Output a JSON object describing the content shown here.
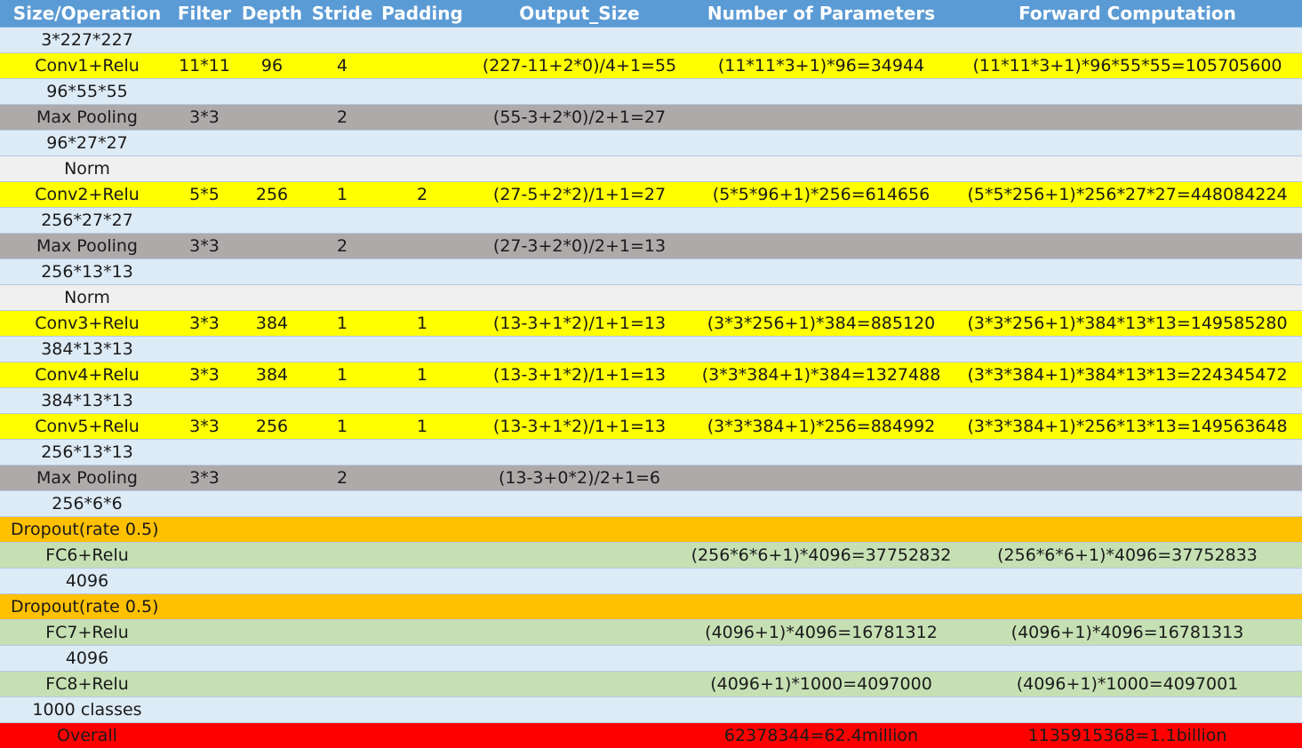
{
  "table": {
    "headers": [
      "Size/Operation",
      "Filter",
      "Depth",
      "Stride",
      "Padding",
      "Output_Size",
      "Number of Parameters",
      "Forward Computation"
    ],
    "rows": [
      {
        "kind": "size",
        "cells": [
          "3*227*227",
          "",
          "",
          "",
          "",
          "",
          "",
          ""
        ]
      },
      {
        "kind": "conv",
        "cells": [
          "Conv1+Relu",
          "11*11",
          "96",
          "4",
          "",
          "(227-11+2*0)/4+1=55",
          "(11*11*3+1)*96=34944",
          "(11*11*3+1)*96*55*55=105705600"
        ]
      },
      {
        "kind": "size",
        "cells": [
          "96*55*55",
          "",
          "",
          "",
          "",
          "",
          "",
          ""
        ]
      },
      {
        "kind": "pool",
        "cells": [
          "Max Pooling",
          "3*3",
          "",
          "2",
          "",
          "(55-3+2*0)/2+1=27",
          "",
          ""
        ]
      },
      {
        "kind": "size",
        "cells": [
          "96*27*27",
          "",
          "",
          "",
          "",
          "",
          "",
          ""
        ]
      },
      {
        "kind": "norm",
        "cells": [
          "Norm",
          "",
          "",
          "",
          "",
          "",
          "",
          ""
        ]
      },
      {
        "kind": "conv",
        "cells": [
          "Conv2+Relu",
          "5*5",
          "256",
          "1",
          "2",
          "(27-5+2*2)/1+1=27",
          "(5*5*96+1)*256=614656",
          "(5*5*256+1)*256*27*27=448084224"
        ]
      },
      {
        "kind": "size",
        "cells": [
          "256*27*27",
          "",
          "",
          "",
          "",
          "",
          "",
          ""
        ]
      },
      {
        "kind": "pool",
        "cells": [
          "Max Pooling",
          "3*3",
          "",
          "2",
          "",
          "(27-3+2*0)/2+1=13",
          "",
          ""
        ]
      },
      {
        "kind": "size",
        "cells": [
          "256*13*13",
          "",
          "",
          "",
          "",
          "",
          "",
          ""
        ]
      },
      {
        "kind": "norm",
        "cells": [
          "Norm",
          "",
          "",
          "",
          "",
          "",
          "",
          ""
        ]
      },
      {
        "kind": "conv",
        "cells": [
          "Conv3+Relu",
          "3*3",
          "384",
          "1",
          "1",
          "(13-3+1*2)/1+1=13",
          "(3*3*256+1)*384=885120",
          "(3*3*256+1)*384*13*13=149585280"
        ]
      },
      {
        "kind": "size",
        "cells": [
          "384*13*13",
          "",
          "",
          "",
          "",
          "",
          "",
          ""
        ]
      },
      {
        "kind": "conv",
        "cells": [
          "Conv4+Relu",
          "3*3",
          "384",
          "1",
          "1",
          "(13-3+1*2)/1+1=13",
          "(3*3*384+1)*384=1327488",
          "(3*3*384+1)*384*13*13=224345472"
        ]
      },
      {
        "kind": "size",
        "cells": [
          "384*13*13",
          "",
          "",
          "",
          "",
          "",
          "",
          ""
        ]
      },
      {
        "kind": "conv",
        "cells": [
          "Conv5+Relu",
          "3*3",
          "256",
          "1",
          "1",
          "(13-3+1*2)/1+1=13",
          "(3*3*384+1)*256=884992",
          "(3*3*384+1)*256*13*13=149563648"
        ]
      },
      {
        "kind": "size",
        "cells": [
          "256*13*13",
          "",
          "",
          "",
          "",
          "",
          "",
          ""
        ]
      },
      {
        "kind": "pool",
        "cells": [
          "Max Pooling",
          "3*3",
          "",
          "2",
          "",
          "(13-3+0*2)/2+1=6",
          "",
          ""
        ]
      },
      {
        "kind": "size",
        "cells": [
          "256*6*6",
          "",
          "",
          "",
          "",
          "",
          "",
          ""
        ]
      },
      {
        "kind": "drop",
        "cells": [
          "Dropout(rate 0.5)",
          "",
          "",
          "",
          "",
          "",
          "",
          ""
        ]
      },
      {
        "kind": "fc",
        "cells": [
          "FC6+Relu",
          "",
          "",
          "",
          "",
          "",
          "(256*6*6+1)*4096=37752832",
          "(256*6*6+1)*4096=37752833"
        ]
      },
      {
        "kind": "size",
        "cells": [
          "4096",
          "",
          "",
          "",
          "",
          "",
          "",
          ""
        ]
      },
      {
        "kind": "drop",
        "cells": [
          "Dropout(rate 0.5)",
          "",
          "",
          "",
          "",
          "",
          "",
          ""
        ]
      },
      {
        "kind": "fc",
        "cells": [
          "FC7+Relu",
          "",
          "",
          "",
          "",
          "",
          "(4096+1)*4096=16781312",
          "(4096+1)*4096=16781313"
        ]
      },
      {
        "kind": "size",
        "cells": [
          "4096",
          "",
          "",
          "",
          "",
          "",
          "",
          ""
        ]
      },
      {
        "kind": "fc",
        "cells": [
          "FC8+Relu",
          "",
          "",
          "",
          "",
          "",
          "(4096+1)*1000=4097000",
          "(4096+1)*1000=4097001"
        ]
      },
      {
        "kind": "size",
        "cells": [
          "1000 classes",
          "",
          "",
          "",
          "",
          "",
          "",
          ""
        ]
      },
      {
        "kind": "overall",
        "cells": [
          "Overall",
          "",
          "",
          "",
          "",
          "",
          "62378344=62.4million",
          "1135915368=1.1billion"
        ]
      }
    ]
  },
  "colors": {
    "header": "#5b9bd5",
    "size_row": "#ddebf7",
    "conv_row": "#ffff00",
    "pool_row": "#aeaaaa",
    "norm_row": "#f0f0f0",
    "dropout_row": "#ffc000",
    "fc_row": "#c6e0b4",
    "overall_row": "#ff0000"
  }
}
